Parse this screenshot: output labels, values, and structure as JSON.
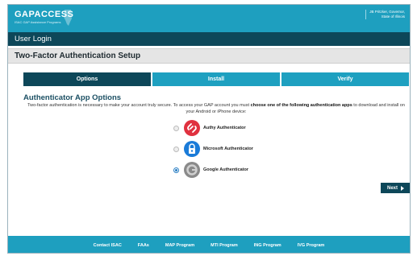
{
  "header": {
    "logo_text": "GAPACCESS",
    "logo_subtitle": "ISAC GAP Assistance Programs",
    "governor_line1": "JB Pritzker, Governor,",
    "governor_line2": "State of Illinois"
  },
  "login_bar": {
    "title": "User Login"
  },
  "section": {
    "title": "Two-Factor Authentication Setup"
  },
  "steps": [
    {
      "label": "Options",
      "active": true
    },
    {
      "label": "Install",
      "active": false
    },
    {
      "label": "Verify",
      "active": false
    }
  ],
  "content": {
    "heading": "Authenticator App Options",
    "desc_part1": "Two-factor authentication is necessary to make your account truly secure. To access your GAP account you must ",
    "desc_bold": "choose one of the following authentication apps",
    "desc_part2": " to download and install on your Android or iPhone device:"
  },
  "options": [
    {
      "label": "Authy Authenticator",
      "icon": "authy-icon",
      "color": "#e0313f",
      "selected": false
    },
    {
      "label": "Microsoft Authenticator",
      "icon": "microsoft-authenticator-icon",
      "color": "#1a7bd8",
      "selected": false
    },
    {
      "label": "Google Authenticator",
      "icon": "google-authenticator-icon",
      "color": "#7a7a7a",
      "selected": true
    }
  ],
  "next_button": {
    "label": "Next"
  },
  "footer": {
    "links": [
      "Contact ISAC",
      "FAAs",
      "MAP Program",
      "MTI Program",
      "ING Program",
      "IVG Program"
    ]
  },
  "colors": {
    "accent": "#1e9fbf",
    "dark": "#0d4759"
  }
}
